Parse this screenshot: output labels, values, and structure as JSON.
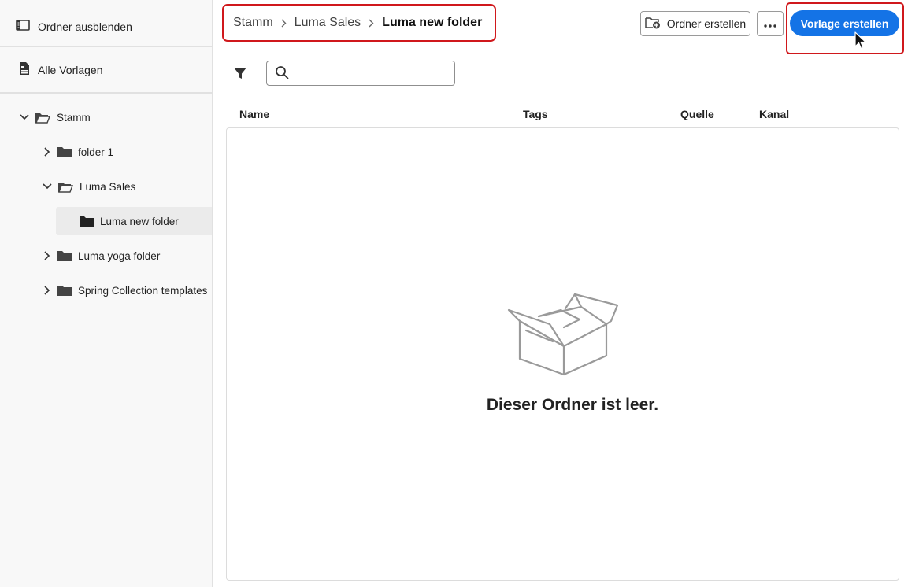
{
  "sidebar": {
    "hide_folders_label": "Ordner ausblenden",
    "all_templates_label": "Alle Vorlagen",
    "tree": {
      "root": "Stamm",
      "items": [
        {
          "label": "folder 1"
        },
        {
          "label": "Luma Sales"
        },
        {
          "label": "Luma new folder"
        },
        {
          "label": "Luma yoga folder"
        },
        {
          "label": "Spring Collection templates"
        }
      ]
    }
  },
  "breadcrumb": {
    "items": [
      "Stamm",
      "Luma Sales"
    ],
    "current": "Luma new folder"
  },
  "toolbar": {
    "create_folder_label": "Ordner erstellen",
    "more_icon": "more-horizontal-icon",
    "create_template_label": "Vorlage erstellen"
  },
  "search": {
    "value": "",
    "placeholder": ""
  },
  "table": {
    "columns": [
      "Name",
      "Tags",
      "Quelle",
      "Kanal"
    ]
  },
  "empty_state": {
    "message": "Dieser Ordner ist leer.",
    "icon": "empty-box-icon"
  },
  "colors": {
    "accent": "#1473e6",
    "highlight": "#d0181c"
  }
}
